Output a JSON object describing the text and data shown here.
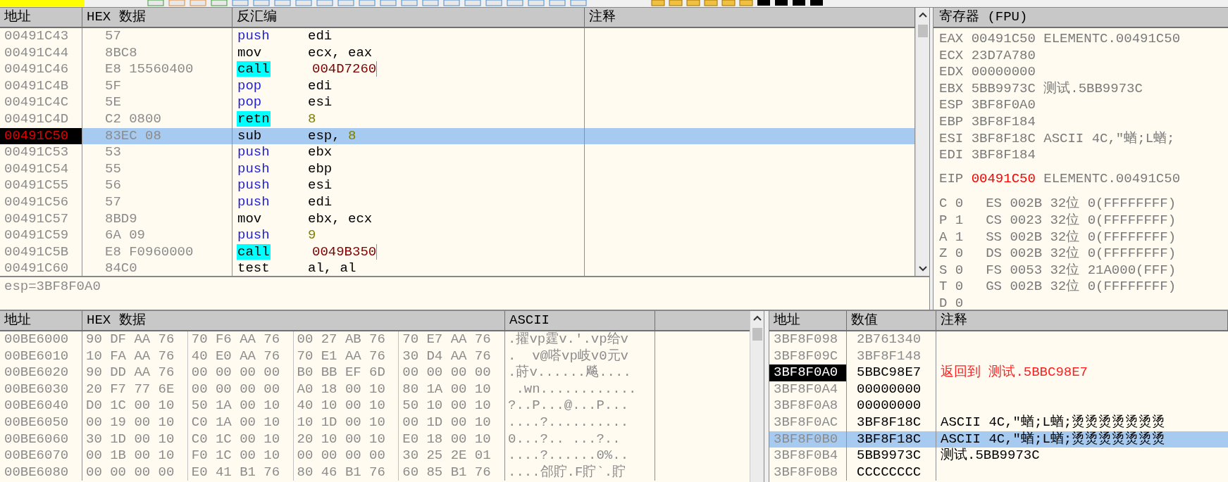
{
  "disasm": {
    "columns": [
      "地址",
      "HEX 数据",
      "反汇编",
      "注释"
    ],
    "rows": [
      {
        "address": "00491C43",
        "hex": "57",
        "mnemonic": "push",
        "kind": "stack",
        "operand": [
          {
            "text": "edi",
            "kind": "reg"
          }
        ],
        "selected": false,
        "current": false
      },
      {
        "address": "00491C44",
        "hex": "8BC8",
        "mnemonic": "mov",
        "kind": "plain",
        "operand": [
          {
            "text": "ecx, eax",
            "kind": "reg"
          }
        ],
        "selected": false,
        "current": false
      },
      {
        "address": "00491C46",
        "hex": "E8 15560400",
        "mnemonic": "call",
        "kind": "branch",
        "operand": [
          {
            "text": "004D7260",
            "kind": "addr"
          }
        ],
        "selected": false,
        "current": false
      },
      {
        "address": "00491C4B",
        "hex": "5F",
        "mnemonic": "pop",
        "kind": "stack",
        "operand": [
          {
            "text": "edi",
            "kind": "reg"
          }
        ],
        "selected": false,
        "current": false
      },
      {
        "address": "00491C4C",
        "hex": "5E",
        "mnemonic": "pop",
        "kind": "stack",
        "operand": [
          {
            "text": "esi",
            "kind": "reg"
          }
        ],
        "selected": false,
        "current": false
      },
      {
        "address": "00491C4D",
        "hex": "C2 0800",
        "mnemonic": "retn",
        "kind": "branch",
        "operand": [
          {
            "text": "8",
            "kind": "imm"
          }
        ],
        "selected": false,
        "current": false
      },
      {
        "address": "00491C50",
        "hex": "83EC 08",
        "mnemonic": "sub",
        "kind": "plain",
        "operand": [
          {
            "text": "esp, ",
            "kind": "reg"
          },
          {
            "text": "8",
            "kind": "imm"
          }
        ],
        "selected": true,
        "current": true
      },
      {
        "address": "00491C53",
        "hex": "53",
        "mnemonic": "push",
        "kind": "stack",
        "operand": [
          {
            "text": "ebx",
            "kind": "reg"
          }
        ],
        "selected": false,
        "current": false
      },
      {
        "address": "00491C54",
        "hex": "55",
        "mnemonic": "push",
        "kind": "stack",
        "operand": [
          {
            "text": "ebp",
            "kind": "reg"
          }
        ],
        "selected": false,
        "current": false
      },
      {
        "address": "00491C55",
        "hex": "56",
        "mnemonic": "push",
        "kind": "stack",
        "operand": [
          {
            "text": "esi",
            "kind": "reg"
          }
        ],
        "selected": false,
        "current": false
      },
      {
        "address": "00491C56",
        "hex": "57",
        "mnemonic": "push",
        "kind": "stack",
        "operand": [
          {
            "text": "edi",
            "kind": "reg"
          }
        ],
        "selected": false,
        "current": false
      },
      {
        "address": "00491C57",
        "hex": "8BD9",
        "mnemonic": "mov",
        "kind": "plain",
        "operand": [
          {
            "text": "ebx, ecx",
            "kind": "reg"
          }
        ],
        "selected": false,
        "current": false
      },
      {
        "address": "00491C59",
        "hex": "6A 09",
        "mnemonic": "push",
        "kind": "stack",
        "operand": [
          {
            "text": "9",
            "kind": "imm"
          }
        ],
        "selected": false,
        "current": false
      },
      {
        "address": "00491C5B",
        "hex": "E8 F0960000",
        "mnemonic": "call",
        "kind": "branch",
        "operand": [
          {
            "text": "0049B350",
            "kind": "addr"
          }
        ],
        "selected": false,
        "current": false
      },
      {
        "address": "00491C60",
        "hex": "84C0",
        "mnemonic": "test",
        "kind": "plain",
        "operand": [
          {
            "text": "al, al",
            "kind": "reg"
          }
        ],
        "selected": false,
        "current": false
      }
    ],
    "info": "esp=3BF8F0A0"
  },
  "registers": {
    "title": "寄存器 (FPU)",
    "general": [
      {
        "name": "EAX",
        "value": "00491C50",
        "comment": "ELEMENTC.00491C50",
        "changed": false
      },
      {
        "name": "ECX",
        "value": "23D7A780",
        "changed": false
      },
      {
        "name": "EDX",
        "value": "00000000",
        "changed": false
      },
      {
        "name": "EBX",
        "value": "5BB9973C",
        "comment": "测试.5BB9973C",
        "changed": false
      },
      {
        "name": "ESP",
        "value": "3BF8F0A0",
        "changed": false
      },
      {
        "name": "EBP",
        "value": "3BF8F184",
        "changed": false
      },
      {
        "name": "ESI",
        "value": "3BF8F18C",
        "comment": "ASCII 4C,\"蝤;L蝤;",
        "changed": false
      },
      {
        "name": "EDI",
        "value": "3BF8F184",
        "changed": false
      }
    ],
    "eip": {
      "name": "EIP",
      "value": "00491C50",
      "comment": "ELEMENTC.00491C50",
      "changed": true
    },
    "flags": [
      {
        "flag": "C 0",
        "segment": "ES 002B 32位 0(FFFFFFFF)"
      },
      {
        "flag": "P 1",
        "segment": "CS 0023 32位 0(FFFFFFFF)"
      },
      {
        "flag": "A 1",
        "segment": "SS 002B 32位 0(FFFFFFFF)"
      },
      {
        "flag": "Z 0",
        "segment": "DS 002B 32位 0(FFFFFFFF)"
      },
      {
        "flag": "S 0",
        "segment": "FS 0053 32位 21A000(FFF)"
      },
      {
        "flag": "T 0",
        "segment": "GS 002B 32位 0(FFFFFFFF)"
      },
      {
        "flag": "D 0"
      }
    ]
  },
  "dump": {
    "columns": [
      "地址",
      "HEX 数据",
      "ASCII"
    ],
    "rows": [
      {
        "address": "00BE6000",
        "groups": [
          "90 DF AA 76",
          "70 F6 AA 76",
          "00 27 AB 76",
          "70 E7 AA 76"
        ],
        "ascii": ".擢vp霆v.'.vp给v"
      },
      {
        "address": "00BE6010",
        "groups": [
          "10 FA AA 76",
          "40 E0 AA 76",
          "70 E1 AA 76",
          "30 D4 AA 76"
        ],
        "ascii": ".  v@嗒vp岐v0元v"
      },
      {
        "address": "00BE6020",
        "groups": [
          "90 DD AA 76",
          "00 00 00 00",
          "B0 BB EF 6D",
          "00 00 00 00"
        ],
        "ascii": ".莳v......飚...."
      },
      {
        "address": "00BE6030",
        "groups": [
          "20 F7 77 6E",
          "00 00 00 00",
          "A0 18 00 10",
          "80 1A 00 10"
        ],
        "ascii": " .wn............"
      },
      {
        "address": "00BE6040",
        "groups": [
          "D0 1C 00 10",
          "50 1A 00 10",
          "40 10 00 10",
          "50 10 00 10"
        ],
        "ascii": "?..P...@...P..."
      },
      {
        "address": "00BE6050",
        "groups": [
          "00 19 00 10",
          "C0 1A 00 10",
          "10 1D 00 10",
          "00 1D 00 10"
        ],
        "ascii": "....?.........."
      },
      {
        "address": "00BE6060",
        "groups": [
          "30 1D 00 10",
          "C0 1C 00 10",
          "20 10 00 10",
          "E0 18 00 10"
        ],
        "ascii": "0...?.. ...?.."
      },
      {
        "address": "00BE6070",
        "groups": [
          "00 1B 00 10",
          "F0 1C 00 10",
          "00 00 00 00",
          "30 25 2E 01"
        ],
        "ascii": "....?......0%.."
      },
      {
        "address": "00BE6080",
        "groups": [
          "00 00 00 00",
          "E0 41 B1 76",
          "80 46 B1 76",
          "60 85 B1 76"
        ],
        "ascii": "....郃貯.F貯`.貯"
      }
    ]
  },
  "stack": {
    "columns": [
      "地址",
      "数值",
      "注释"
    ],
    "rows": [
      {
        "address": "3BF8F098",
        "value": "2B761340",
        "inactive": true,
        "selected": false,
        "current": false
      },
      {
        "address": "3BF8F09C",
        "value": "3BF8F148",
        "inactive": true,
        "selected": false,
        "current": false
      },
      {
        "address": "3BF8F0A0",
        "value": "5BBC98E7",
        "comment": "返回到 测试.5BBC98E7",
        "kind": "return",
        "inactive": false,
        "selected": false,
        "current": true
      },
      {
        "address": "3BF8F0A4",
        "value": "00000000",
        "inactive": false,
        "selected": false,
        "current": false
      },
      {
        "address": "3BF8F0A8",
        "value": "00000000",
        "inactive": false,
        "selected": false,
        "current": false
      },
      {
        "address": "3BF8F0AC",
        "value": "3BF8F18C",
        "comment": "ASCII 4C,\"蝤;L蝤;烫烫烫烫烫烫烫",
        "kind": "plain",
        "inactive": false,
        "selected": false,
        "current": false
      },
      {
        "address": "3BF8F0B0",
        "value": "3BF8F18C",
        "comment": "ASCII 4C,\"蝤;L蝤;烫烫烫烫烫烫烫",
        "kind": "plain",
        "inactive": false,
        "selected": true,
        "current": false
      },
      {
        "address": "3BF8F0B4",
        "value": "5BB9973C",
        "comment": "测试.5BB9973C",
        "kind": "plain",
        "inactive": false,
        "selected": false,
        "current": false
      },
      {
        "address": "3BF8F0B8",
        "value": "CCCCCCCC",
        "inactive": false,
        "selected": false,
        "current": false
      }
    ]
  }
}
